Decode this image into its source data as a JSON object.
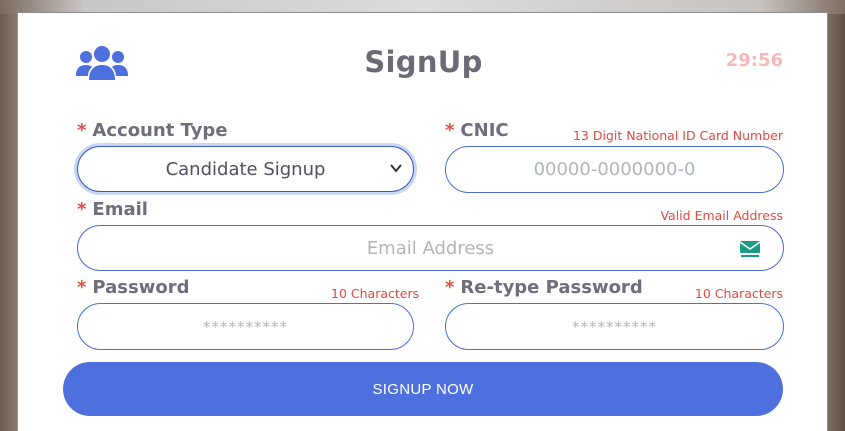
{
  "header": {
    "title": "SignUp",
    "timer": "29:56"
  },
  "form": {
    "account_type": {
      "label": "Account Type",
      "required_mark": "*",
      "selected": "Candidate Signup"
    },
    "cnic": {
      "label": "CNIC",
      "required_mark": "*",
      "hint": "13 Digit National ID Card Number",
      "placeholder": "00000-0000000-0"
    },
    "email": {
      "label": "Email",
      "required_mark": "*",
      "hint": "Valid Email Address",
      "placeholder": "Email Address"
    },
    "password": {
      "label": "Password",
      "required_mark": "*",
      "hint": "10 Characters",
      "placeholder": "**********"
    },
    "retype_password": {
      "label": "Re-type Password",
      "required_mark": "*",
      "hint": "10 Characters",
      "placeholder": "**********"
    },
    "submit_label": "SIGNUP NOW"
  },
  "icons": {
    "header_icon": "users-icon",
    "email_field_icon": "mail-icon",
    "select_icon": "chevron-down-icon"
  },
  "colors": {
    "accent": "#4e70de",
    "required": "#e04a3f",
    "timer": "#f6b9b9",
    "label": "#6e6e7c"
  }
}
